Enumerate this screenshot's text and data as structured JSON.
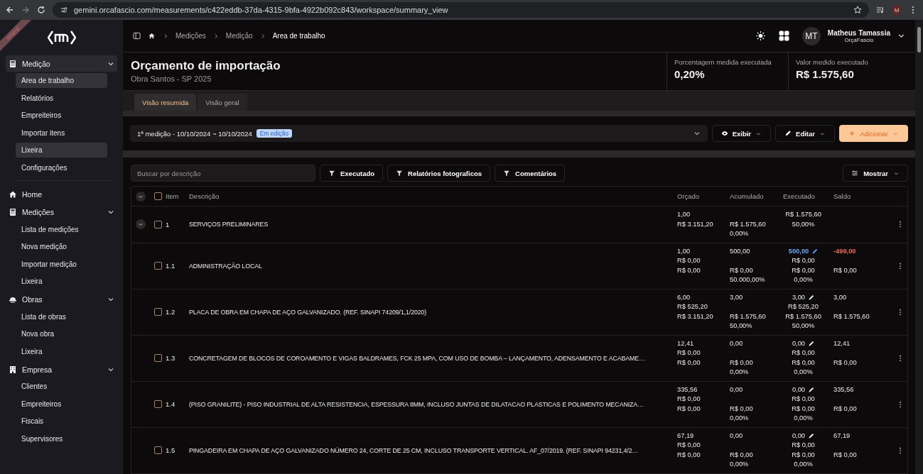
{
  "browser": {
    "url": "gemini.orcafascio.com/measurements/c422eddb-37da-4315-9bfa-4922b092c843/workspace/summary_view",
    "profile": "M"
  },
  "ribbon": "staging",
  "sidebar": {
    "groups": [
      {
        "label": "Medição",
        "expanded": true,
        "selected": true,
        "children": [
          {
            "label": "Area de trabalho",
            "highlighted": true
          },
          {
            "label": "Relatórios",
            "highlighted": false
          },
          {
            "label": "Empreiteiros",
            "highlighted": false
          },
          {
            "label": "Importar itens",
            "highlighted": false
          },
          {
            "label": "Lixeira",
            "highlighted": true
          },
          {
            "label": "Configurações",
            "highlighted": false
          }
        ]
      },
      {
        "label": "Home",
        "selected": false
      },
      {
        "label": "Medições",
        "expanded": true,
        "selected": false,
        "children": [
          {
            "label": "Lista de medições",
            "highlighted": false
          },
          {
            "label": "Nova medição",
            "highlighted": false
          },
          {
            "label": "Importar medição",
            "highlighted": false
          },
          {
            "label": "Lixeira",
            "highlighted": false
          }
        ]
      },
      {
        "label": "Obras",
        "expanded": true,
        "selected": false,
        "children": [
          {
            "label": "Lista de obras",
            "highlighted": false
          },
          {
            "label": "Nova obra",
            "highlighted": false
          },
          {
            "label": "Lixeira",
            "highlighted": false
          }
        ]
      },
      {
        "label": "Empresa",
        "expanded": true,
        "selected": false,
        "children": [
          {
            "label": "Clientes",
            "highlighted": false
          },
          {
            "label": "Empreiteiros",
            "highlighted": false
          },
          {
            "label": "Fiscais",
            "highlighted": false
          },
          {
            "label": "Supervisores",
            "highlighted": false
          }
        ]
      }
    ]
  },
  "breadcrumbs": [
    "Medições",
    "Medição",
    "Area de trabalho"
  ],
  "user": {
    "initials": "MT",
    "name": "Matheus Tamassia",
    "company": "OrçaFascio"
  },
  "header": {
    "title": "Orçamento de importação",
    "subtitle": "Obra Santos - SP 2025"
  },
  "stats": [
    {
      "label": "Porcentagem medida executada",
      "value": "0,20%"
    },
    {
      "label": "Valor medido executado",
      "value": "R$ 1.575,60"
    }
  ],
  "tabs": [
    {
      "label": "Visão resumida",
      "selected": true
    },
    {
      "label": "Visão geral",
      "selected": false
    }
  ],
  "measurement": {
    "label": "1ª medição - 10/10/2024 ~ 10/10/2024",
    "badge": "Em edição"
  },
  "actions": [
    {
      "label": "Exibir",
      "kind": "view"
    },
    {
      "label": "Editar",
      "kind": "edit"
    },
    {
      "label": "Adicionar",
      "kind": "primary"
    }
  ],
  "search": {
    "placeholder": "Buscar por descrição"
  },
  "filters": [
    "Executado",
    "Relatórios fotograficos",
    "Comentários"
  ],
  "show_button": "Mostrar",
  "table": {
    "header_checked": false,
    "columns": [
      "Item",
      "Descrição",
      "Orçado",
      "Acumulado",
      "Executado",
      "Saldo"
    ],
    "rows": [
      {
        "kind": "group",
        "item": "1",
        "checked": false,
        "description": "SERVIÇOS PRELIMINARES",
        "orcado": {
          "line_1": "1,00",
          "line_2": "R$ 3.151,20"
        },
        "acumulado": {
          "line_2": "R$ 1.575,60",
          "line_3": "0,00%"
        },
        "executado": {
          "line_1": "R$ 1.575,60",
          "line_2": "50,00%",
          "edited": false
        },
        "saldo": {}
      },
      {
        "kind": "item",
        "item": "1.1",
        "checked": false,
        "description": "ADMINISTRAÇÃO LOCAL",
        "orcado": {
          "line_1": "1,00",
          "line_2": "R$ 0,00",
          "line_3": "R$ 0,00"
        },
        "acumulado": {
          "line_1": "500,00",
          "line_3": "R$ 0,00",
          "line_4": "50.000,00%"
        },
        "executado": {
          "line_1": "500,00",
          "line_2": "R$ 0,00",
          "line_3": "R$ 0,00",
          "line_4": "0,00%",
          "edited": true
        },
        "saldo": {
          "line_1": "-499,00",
          "line_3": "R$ 0,00",
          "negative": true
        }
      },
      {
        "kind": "item",
        "item": "1.2",
        "checked": false,
        "description": "PLACA DE OBRA EM CHAPA DE AÇO GALVANIZADO. (REF. SINAPI 74209/1,1/2020)",
        "orcado": {
          "line_1": "6,00",
          "line_2": "R$ 525,20",
          "line_3": "R$ 3.151,20"
        },
        "acumulado": {
          "line_1": "3,00",
          "line_3": "R$ 1.575,60",
          "line_4": "50,00%"
        },
        "executado": {
          "line_1": "3,00",
          "line_2": "R$ 525,20",
          "line_3": "R$ 1.575,60",
          "line_4": "50,00%",
          "edited": false
        },
        "saldo": {
          "line_1": "3,00",
          "line_3": "R$ 1.575,60",
          "negative": false
        }
      },
      {
        "kind": "item",
        "item": "1.3",
        "checked": false,
        "description": "CONCRETAGEM DE BLOCOS DE COROAMENTO E VIGAS BALDRAMES, FCK 25 MPA, COM USO DE BOMBA – LANÇAMENTO, ADENSAMENTO E ACABAME…",
        "orcado": {
          "line_1": "12,41",
          "line_2": "R$ 0,00",
          "line_3": "R$ 0,00"
        },
        "acumulado": {
          "line_1": "0,00",
          "line_3": "R$ 0,00",
          "line_4": "0,00%"
        },
        "executado": {
          "line_1": "0,00",
          "line_2": "R$ 0,00",
          "line_3": "R$ 0,00",
          "line_4": "0,00%",
          "edited": false
        },
        "saldo": {
          "line_1": "12,41",
          "line_3": "R$ 0,00",
          "negative": false
        }
      },
      {
        "kind": "item",
        "item": "1.4",
        "checked": false,
        "description": "(PISO GRANILITE) - PISO INDUSTRIAL DE ALTA RESISTENCIA, ESPESSURA 8MM, INCLUSO JUNTAS DE DILATACAO PLASTICAS E POLIMENTO MECANIZA…",
        "orcado": {
          "line_1": "335,56",
          "line_2": "R$ 0,00",
          "line_3": "R$ 0,00"
        },
        "acumulado": {
          "line_1": "0,00",
          "line_3": "R$ 0,00",
          "line_4": "0,00%"
        },
        "executado": {
          "line_1": "0,00",
          "line_2": "R$ 0,00",
          "line_3": "R$ 0,00",
          "line_4": "0,00%",
          "edited": false
        },
        "saldo": {
          "line_1": "335,56",
          "line_3": "R$ 0,00",
          "negative": false
        }
      },
      {
        "kind": "item",
        "item": "1.5",
        "checked": false,
        "description": "PINGADEIRA EM CHAPA DE AÇO GALVANIZADO NÚMERO 24, CORTE DE 25 CM, INCLUSO TRANSPORTE VERTICAL. AF_07/2019. (REF. SINAPI 94231,4/2…",
        "orcado": {
          "line_1": "67,19",
          "line_2": "R$ 0,00",
          "line_3": "R$ 0,00"
        },
        "acumulado": {
          "line_1": "0,00",
          "line_3": "R$ 0,00",
          "line_4": "0,00%"
        },
        "executado": {
          "line_1": "0,00",
          "line_2": "R$ 0,00",
          "line_3": "R$ 0,00",
          "line_4": "0,00%",
          "edited": false
        },
        "saldo": {
          "line_1": "67,19",
          "line_3": "R$ 0,00",
          "negative": false
        }
      }
    ]
  }
}
